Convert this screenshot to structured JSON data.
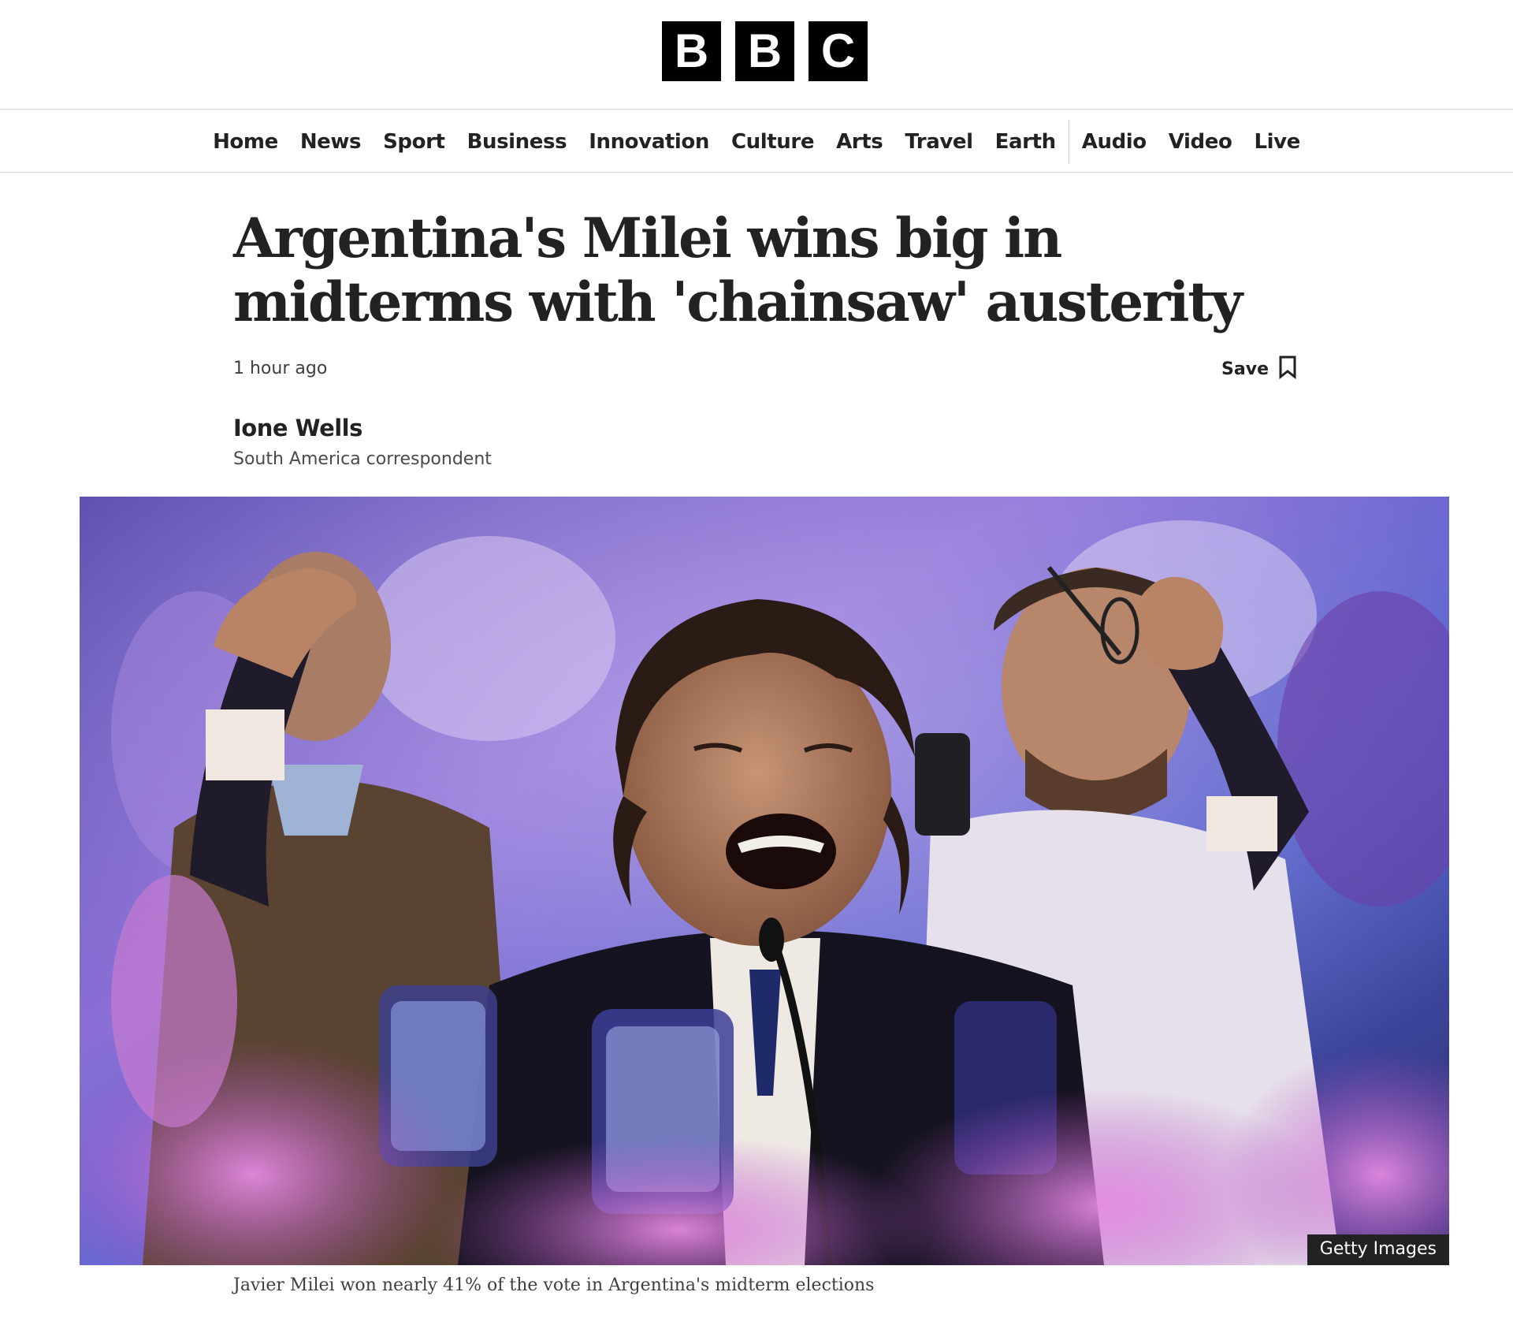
{
  "brand": {
    "letters": [
      "B",
      "B",
      "C"
    ]
  },
  "nav": {
    "items": [
      "Home",
      "News",
      "Sport",
      "Business",
      "Innovation",
      "Culture",
      "Arts",
      "Travel",
      "Earth"
    ],
    "secondary_items": [
      "Audio",
      "Video",
      "Live"
    ]
  },
  "article": {
    "headline": "Argentina's Milei wins big in midterms with 'chainsaw' austerity",
    "timestamp": "1 hour ago",
    "save_label": "Save",
    "author": "Ione Wells",
    "author_role": "South America correspondent",
    "image": {
      "credit": "Getty Images",
      "caption": "Javier Milei won nearly 41% of the vote in Argentina's midterm elections"
    }
  },
  "icons": {
    "save": "bookmark-icon"
  }
}
